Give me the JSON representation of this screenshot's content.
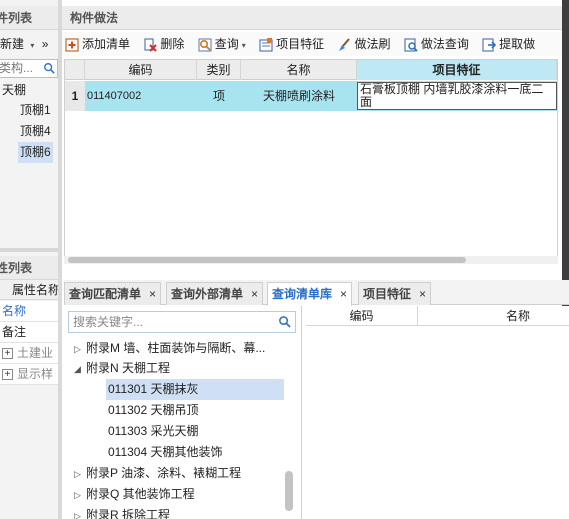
{
  "colors": {
    "selection": "#cfe0f5",
    "grid_row": "#a8e4f0",
    "active_tab_text": "#2a6fc7",
    "property_name_text": "#2a6fc7"
  },
  "left_panel": {
    "title": "件列表",
    "toolbar": {
      "new_label": "新建",
      "new_caret": "▾",
      "more": "»"
    },
    "search": {
      "text": "类构...",
      "icon": "search-icon"
    },
    "tree": {
      "root": "天棚",
      "children": [
        "顶棚1",
        "顶棚4",
        "顶棚6"
      ],
      "selected": "顶棚6"
    },
    "properties": {
      "title": "性列表",
      "header": "属性名称",
      "rows": [
        {
          "label": "名称"
        },
        {
          "label": "备注"
        },
        {
          "label": "土建业",
          "expand": "+"
        },
        {
          "label": "显示样",
          "expand": "+"
        }
      ]
    }
  },
  "right_panel": {
    "title": "构件做法",
    "toolbar": {
      "add_list": "添加清单",
      "delete": "删除",
      "query": "查询",
      "query_caret": "▾",
      "item_features": "项目特征",
      "method_brush": "做法刷",
      "method_query": "做法查询",
      "extract": "提取做"
    },
    "grid": {
      "headers": {
        "code": "编码",
        "type": "类别",
        "name": "名称",
        "features": "项目特征"
      },
      "row": {
        "num": "1",
        "code": "011407002",
        "type": "项",
        "name": "天棚喷刷涂料",
        "features": "石膏板顶棚 内墙乳胶漆涂料一底二面"
      }
    }
  },
  "bottom_panel": {
    "tabs": [
      {
        "label": "查询匹配清单",
        "close": "×"
      },
      {
        "label": "查询外部清单",
        "close": "×"
      },
      {
        "label": "查询清单库",
        "close": "×",
        "active": true
      },
      {
        "label": "项目特征",
        "close": "×"
      }
    ],
    "search": {
      "placeholder": "搜索关键字...",
      "icon": "search-icon"
    },
    "library_tree": [
      {
        "label": "附录M 墙、柱面装饰与隔断、幕...",
        "toggle": "▷"
      },
      {
        "label": "附录N 天棚工程",
        "toggle": "◢"
      },
      {
        "label": "011301 天棚抹灰",
        "selected": true
      },
      {
        "label": "011302 天棚吊顶"
      },
      {
        "label": "011303 采光天棚"
      },
      {
        "label": "011304 天棚其他装饰"
      },
      {
        "label": "附录P 油漆、涂料、裱糊工程",
        "toggle": "▷"
      },
      {
        "label": "附录Q 其他装饰工程",
        "toggle": "▷"
      },
      {
        "label": "附录R 拆除工程",
        "toggle": "▷"
      }
    ],
    "result_table": {
      "headers": {
        "code": "编码",
        "name": "名称"
      }
    }
  }
}
